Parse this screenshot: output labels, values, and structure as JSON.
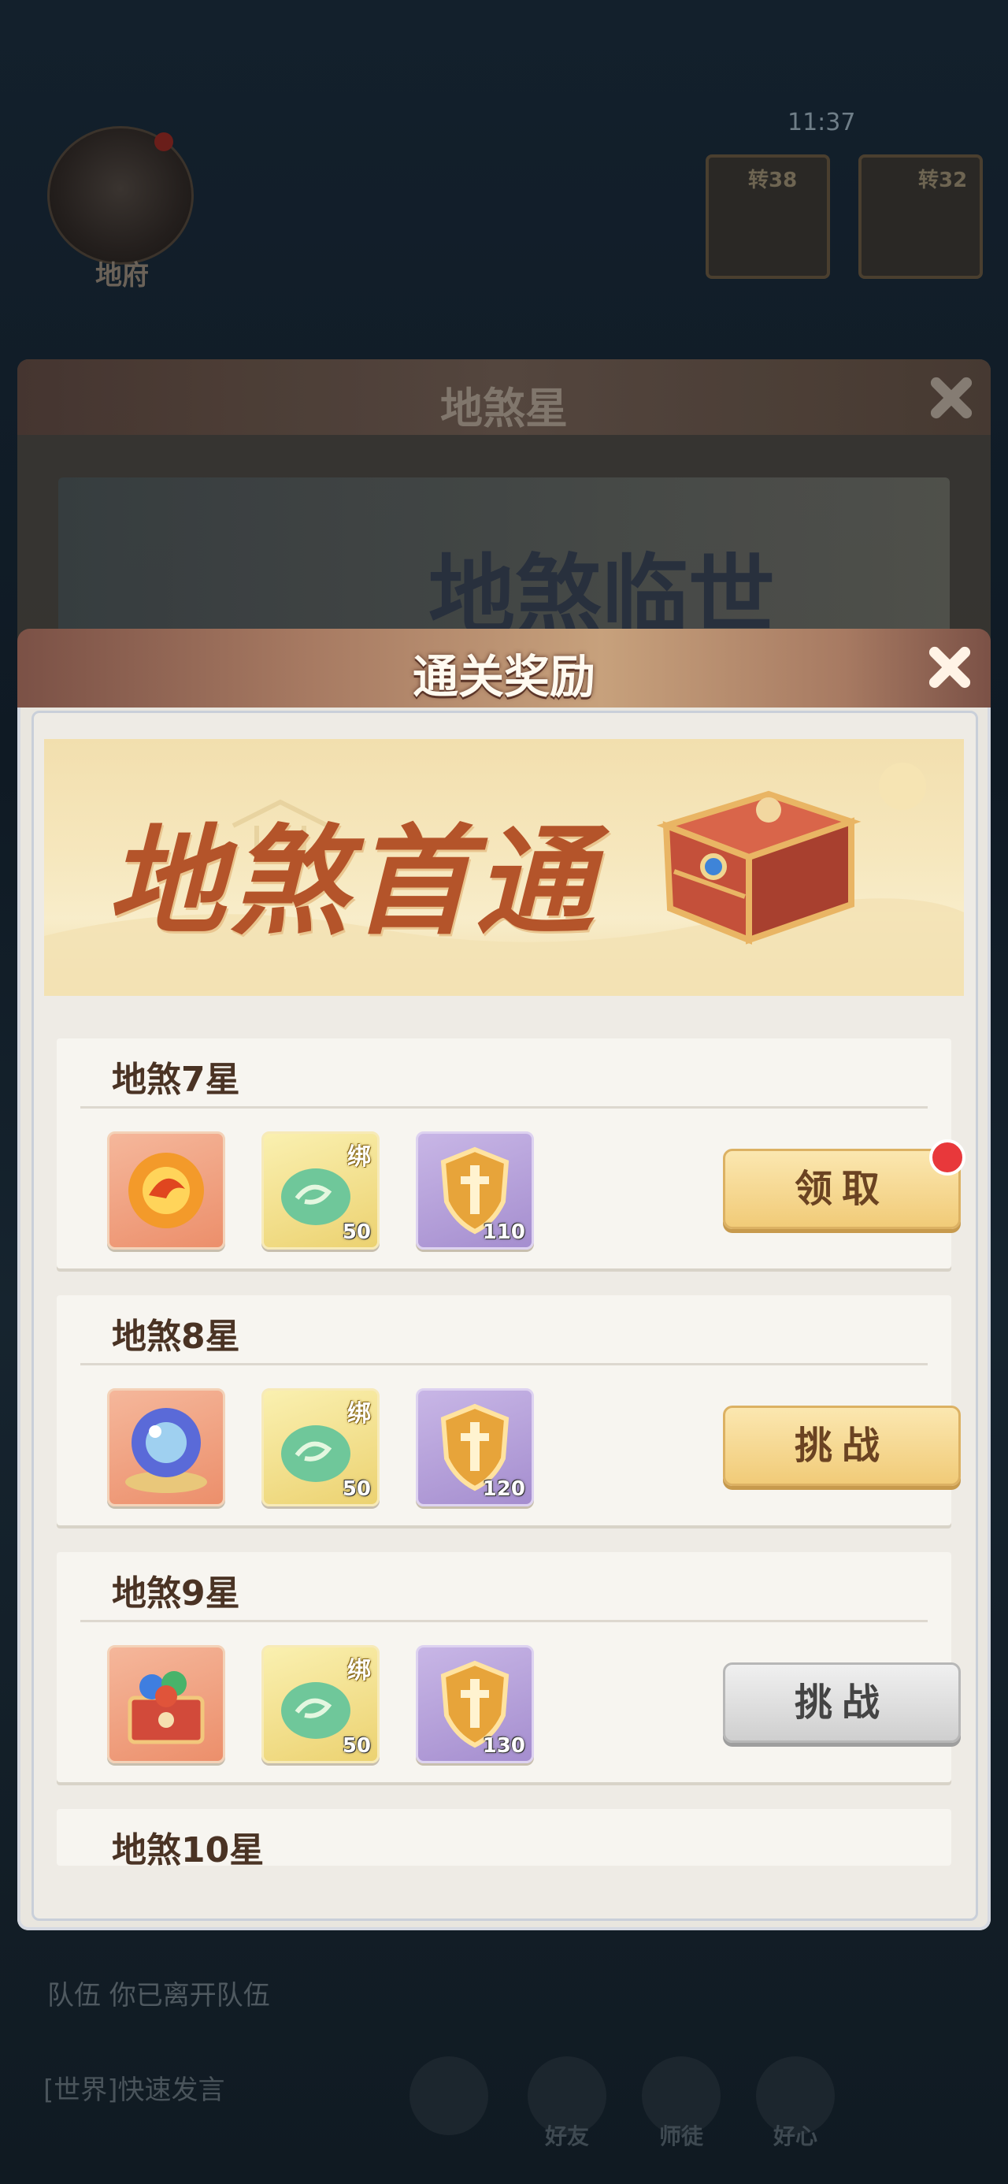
{
  "status": {
    "time": "11:37"
  },
  "hud": {
    "home_label": "地府",
    "portrait_1": "转38",
    "portrait_2": "转32",
    "team_msg": "队伍 你已离开队伍",
    "world_msg": "[世界]快速发言",
    "dock": [
      "好友",
      "师徒",
      "好心"
    ]
  },
  "back_panel": {
    "title": "地煞星",
    "banner_text": "地煞临世"
  },
  "modal": {
    "title": "通关奖励",
    "banner_title": "地煞首通",
    "rows": [
      {
        "title": "地煞7星",
        "items": [
          {
            "icon": "fire-orb-icon",
            "count": ""
          },
          {
            "icon": "jade-cloud-icon",
            "tag": "绑",
            "count": "50"
          },
          {
            "icon": "sword-shield-icon",
            "count": "110"
          }
        ],
        "button": "领取",
        "button_style": "gold",
        "badge": true
      },
      {
        "title": "地煞8星",
        "items": [
          {
            "icon": "crystal-ball-icon",
            "count": ""
          },
          {
            "icon": "jade-cloud-icon",
            "tag": "绑",
            "count": "50"
          },
          {
            "icon": "sword-shield-icon",
            "count": "120"
          }
        ],
        "button": "挑战",
        "button_style": "gold",
        "badge": false
      },
      {
        "title": "地煞9星",
        "items": [
          {
            "icon": "gem-chest-icon",
            "count": ""
          },
          {
            "icon": "jade-cloud-icon",
            "tag": "绑",
            "count": "50"
          },
          {
            "icon": "sword-shield-icon",
            "count": "130"
          }
        ],
        "button": "挑战",
        "button_style": "grey",
        "badge": false
      },
      {
        "title": "地煞10星"
      }
    ]
  }
}
